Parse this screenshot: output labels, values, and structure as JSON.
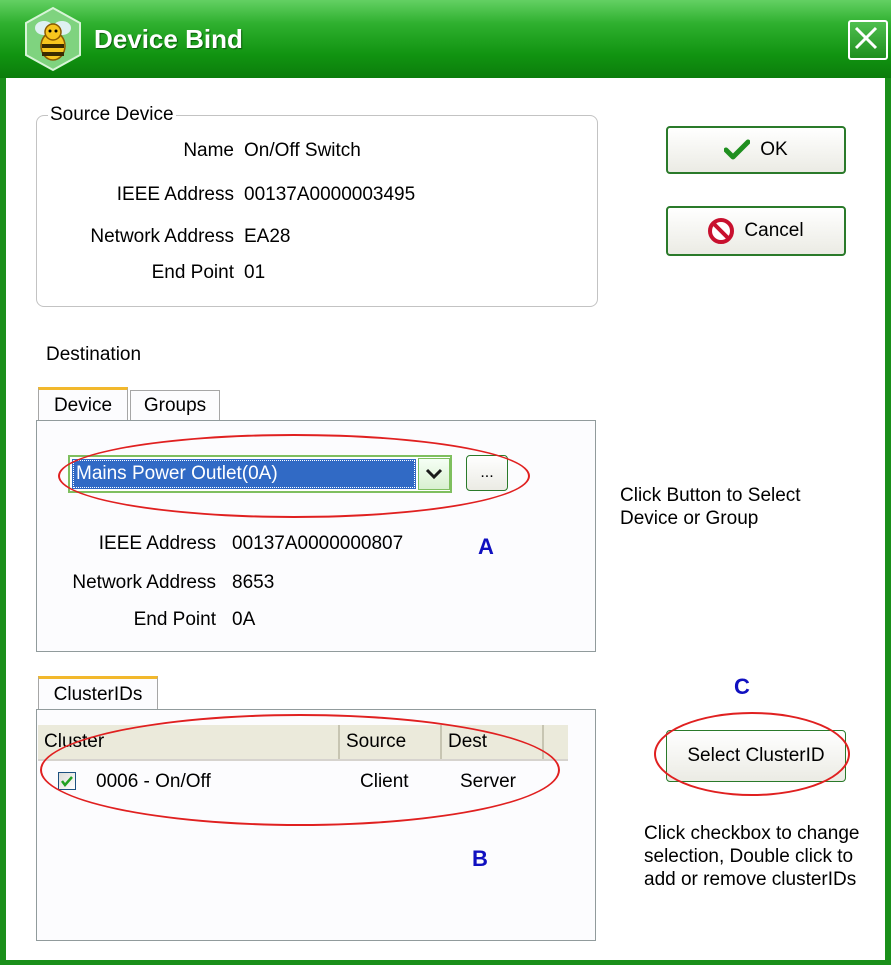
{
  "window": {
    "title": "Device Bind",
    "colors": {
      "titlebar": "#119411",
      "selection": "#316ac5",
      "annotation_red": "#e02020",
      "annotation_blue": "#1010c0"
    }
  },
  "source_device": {
    "group_title": "Source Device",
    "name_label": "Name",
    "name_value": "On/Off Switch",
    "ieee_label": "IEEE Address",
    "ieee_value": "00137A0000003495",
    "network_label": "Network Address",
    "network_value": "EA28",
    "endpoint_label": "End Point",
    "endpoint_value": "01"
  },
  "buttons": {
    "ok_label": "OK",
    "cancel_label": "Cancel",
    "browse_label": "...",
    "select_cluster_label": "Select ClusterID"
  },
  "destination": {
    "heading": "Destination",
    "tabs": [
      {
        "label": "Device",
        "active": true
      },
      {
        "label": "Groups",
        "active": false
      }
    ],
    "selected_device": "Mains Power Outlet(0A)",
    "ieee_label": "IEEE Address",
    "ieee_value": "00137A0000000807",
    "network_label": "Network Address",
    "network_value": "8653",
    "endpoint_label": "End Point",
    "endpoint_value": "0A"
  },
  "hints": {
    "select_device": "Click Button to Select Device or Group",
    "checkbox": "Click checkbox to change selection, Double click to add or remove clusterIDs"
  },
  "clusters": {
    "tab_label": "ClusterIDs",
    "columns": [
      "Cluster",
      "Source",
      "Dest"
    ],
    "rows": [
      {
        "checked": true,
        "cluster": "0006 - On/Off",
        "source": "Client",
        "dest": "Server"
      }
    ]
  },
  "annotations": {
    "a": "A",
    "b": "B",
    "c": "C"
  }
}
